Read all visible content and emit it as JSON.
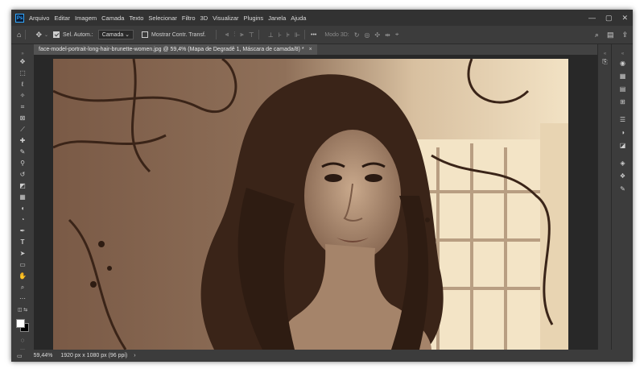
{
  "app": {
    "logo": "Ps"
  },
  "menu": [
    "Arquivo",
    "Editar",
    "Imagem",
    "Camada",
    "Texto",
    "Selecionar",
    "Filtro",
    "3D",
    "Visualizar",
    "Plugins",
    "Janela",
    "Ajuda"
  ],
  "window_controls": {
    "minimize": "—",
    "maximize": "▢",
    "close": "✕"
  },
  "options": {
    "auto_select_label": "Sel. Autom.:",
    "auto_select_value": "Camada",
    "show_transform_label": "Mostrar Contr. Transf.",
    "mode_3d_label": "Modo 3D:",
    "more": "•••"
  },
  "document": {
    "tab_title": "face-model-portrait-long-hair-brunette-women.jpg @ 59,4% (Mapa de Degradê 1, Máscara de camada/8) *",
    "close": "×"
  },
  "status": {
    "zoom": "59,44%",
    "info": "1920 px x 1080 px (96 ppi)",
    "arrow": "›"
  },
  "icons": {
    "home": "home-icon",
    "move": "move-tool-icon",
    "search": "search-icon",
    "workspace": "workspace-icon",
    "share": "share-icon"
  },
  "colors": {
    "foreground": "#ffffff",
    "background": "#000000"
  }
}
